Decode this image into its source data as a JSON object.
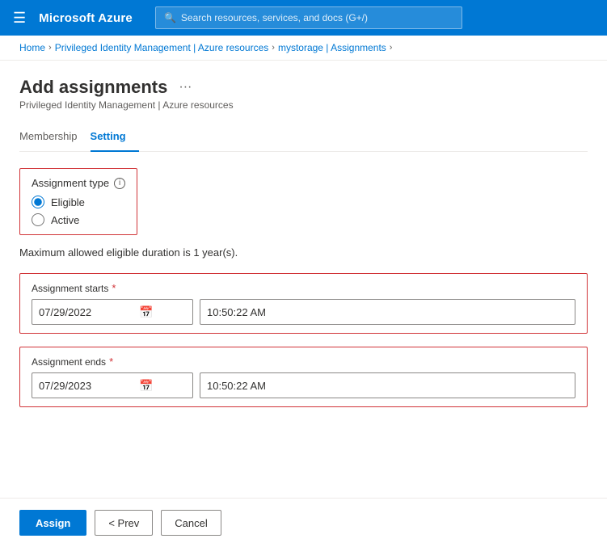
{
  "topbar": {
    "hamburger": "☰",
    "logo": "Microsoft Azure",
    "search_placeholder": "Search resources, services, and docs (G+/)"
  },
  "breadcrumb": {
    "items": [
      {
        "label": "Home",
        "link": true
      },
      {
        "label": "Privileged Identity Management | Azure resources",
        "link": true
      },
      {
        "label": "mystorage | Assignments",
        "link": true
      }
    ],
    "separator": "›"
  },
  "page": {
    "title": "Add assignments",
    "subtitle": "Privileged Identity Management | Azure resources",
    "ellipsis": "···"
  },
  "tabs": [
    {
      "label": "Membership",
      "active": false
    },
    {
      "label": "Setting",
      "active": true
    }
  ],
  "assignment_type": {
    "label": "Assignment type",
    "info_icon": "i",
    "options": [
      {
        "label": "Eligible",
        "value": "eligible",
        "checked": true
      },
      {
        "label": "Active",
        "value": "active",
        "checked": false
      }
    ]
  },
  "info_text": "Maximum allowed eligible duration is 1 year(s).",
  "assignment_starts": {
    "label": "Assignment starts",
    "required": "*",
    "date": "07/29/2022",
    "time": "10:50:22 AM",
    "calendar_icon": "📅"
  },
  "assignment_ends": {
    "label": "Assignment ends",
    "required": "*",
    "date": "07/29/2023",
    "time": "10:50:22 AM",
    "calendar_icon": "📅"
  },
  "footer": {
    "assign_label": "Assign",
    "prev_label": "< Prev",
    "cancel_label": "Cancel"
  }
}
